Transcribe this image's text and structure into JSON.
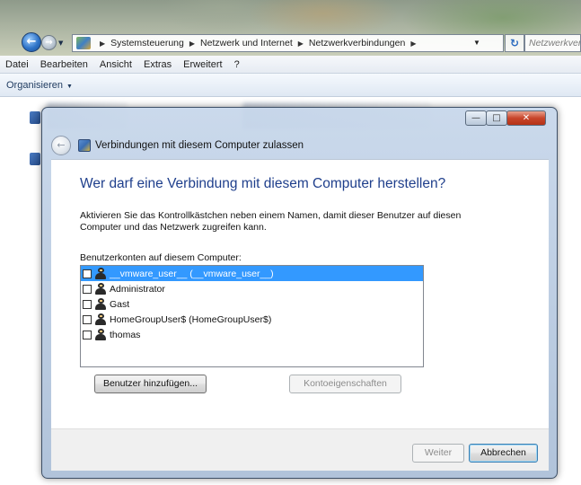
{
  "address": {
    "crumbs": [
      "Systemsteuerung",
      "Netzwerk und Internet",
      "Netzwerkverbindungen"
    ],
    "search_placeholder": "Netzwerkverbi"
  },
  "menubar": {
    "items": [
      "Datei",
      "Bearbeiten",
      "Ansicht",
      "Extras",
      "Erweitert",
      "?"
    ]
  },
  "commandbar": {
    "organize": "Organisieren"
  },
  "dialog": {
    "title": "Verbindungen mit diesem Computer zulassen",
    "main_instruction": "Wer darf eine Verbindung mit diesem Computer herstellen?",
    "description": "Aktivieren Sie das Kontrollkästchen neben einem Namen, damit dieser Benutzer auf diesen Computer und das Netzwerk zugreifen kann.",
    "list_label": "Benutzerkonten auf diesem Computer:",
    "users": [
      {
        "label": "__vmware_user__ (__vmware_user__)",
        "checked": false,
        "selected": true
      },
      {
        "label": "Administrator",
        "checked": false,
        "selected": false
      },
      {
        "label": "Gast",
        "checked": false,
        "selected": false
      },
      {
        "label": "HomeGroupUser$ (HomeGroupUser$)",
        "checked": false,
        "selected": false
      },
      {
        "label": "thomas",
        "checked": false,
        "selected": false
      }
    ],
    "add_user_button": "Benutzer hinzufügen...",
    "account_properties_button": "Kontoeigenschaften",
    "next_button": "Weiter",
    "cancel_button": "Abbrechen"
  },
  "colors": {
    "instruction_blue": "#1f3f8c",
    "selection_blue": "#3399ff"
  }
}
